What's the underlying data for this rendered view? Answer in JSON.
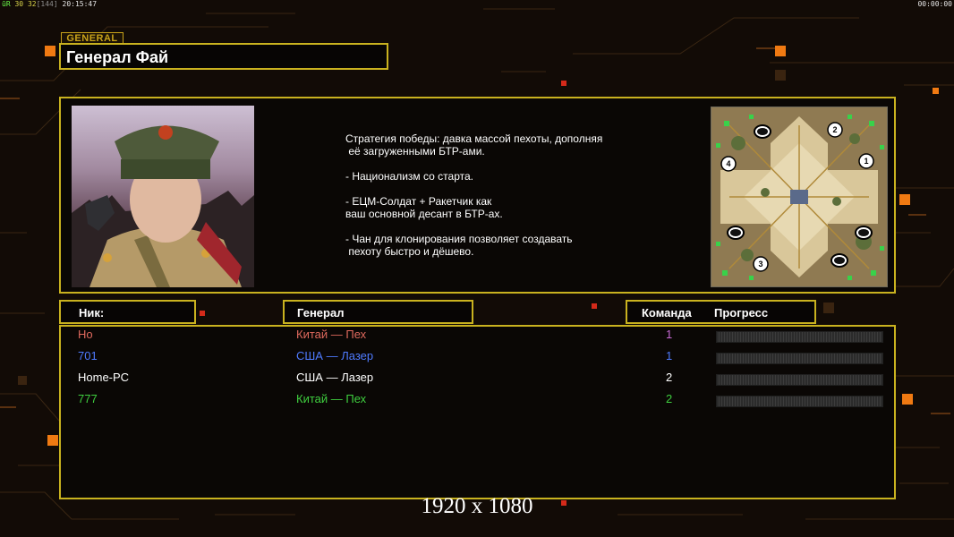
{
  "overlay": {
    "left_prefix": "ūR",
    "left_fps": "30",
    "left_frames": "32",
    "left_bracket": "[144]",
    "left_time": "20:15:47",
    "right_time": "00:00:00"
  },
  "general_tag": "GENERAL",
  "title": "Генерал Фай",
  "description_lines": [
    "Стратегия победы: давка массой пехоты, дополняя",
    " её загруженными БТР-ами.",
    "",
    "- Национализм со старта.",
    "",
    "- ЕЦМ-Солдат + Ракетчик как",
    "ваш основной десант в БТР-ах.",
    "",
    "- Чан для клонирования позволяет создавать",
    " пехоту быстро и дёшево."
  ],
  "minimap": {
    "start_labels": [
      "1",
      "2",
      "3",
      "4"
    ]
  },
  "headers": {
    "nick": "Ник:",
    "general": "Генерал",
    "team": "Команда",
    "progress": "Прогресс"
  },
  "players": [
    {
      "nick": "Ho",
      "general": "Китай — Пех",
      "team": "1",
      "color": "#e06a5e",
      "team_color": "#c86ad6"
    },
    {
      "nick": "701",
      "general": "США — Лазер",
      "team": "1",
      "color": "#4f7bff",
      "team_color": "#4f7bff"
    },
    {
      "nick": "Home-PC",
      "general": "США — Лазер",
      "team": "2",
      "color": "#ffffff",
      "team_color": "#ffffff"
    },
    {
      "nick": "777",
      "general": "Китай — Пех",
      "team": "2",
      "color": "#3fcf3f",
      "team_color": "#3fcf3f"
    }
  ],
  "resolution": "1920 x 1080",
  "colors": {
    "frame": "#c9b21f",
    "background": "#120b06",
    "accent_orange": "#f07a12"
  }
}
